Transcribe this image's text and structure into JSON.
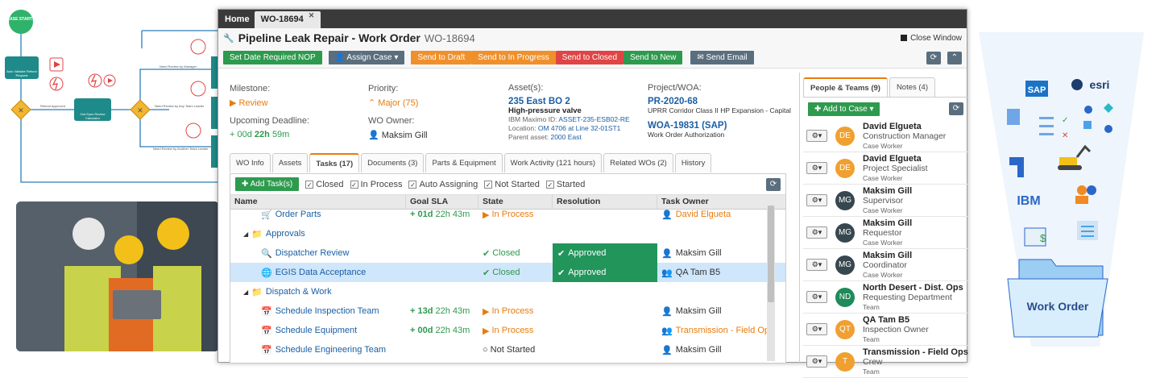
{
  "flow": {
    "start_label": "CASE STARTS",
    "step1_label": "Auto Validate Refund Request",
    "step2_label": "2nd Eyes Review Calculator",
    "refund_approved": "Refund Approved",
    "need_manager": "Need Review by Manager",
    "need_team_leader": "Need Review by Any Team Leader",
    "need_another": "Need Review by Another Team Leader"
  },
  "window": {
    "tabs": [
      {
        "label": "Home"
      },
      {
        "label": "WO-18694"
      }
    ],
    "title": "Pipeline Leak Repair - Work Order",
    "title_id": "WO-18694",
    "close_label": "Close Window"
  },
  "actions": {
    "set_date": "Set Date Required NOP",
    "assign": "Assign Case",
    "send_draft": "Send to Draft",
    "send_progress": "Send to In Progress",
    "send_closed": "Send to Closed",
    "send_new": "Send to New",
    "send_email": "Send Email"
  },
  "info": {
    "milestone_label": "Milestone:",
    "milestone_value": "Review",
    "deadline_label": "Upcoming Deadline:",
    "deadline_value": "+ 00d",
    "deadline_bold": "22h",
    "deadline_rest": "59m",
    "priority_label": "Priority:",
    "priority_value": "Major (75)",
    "owner_label": "WO Owner:",
    "owner_value": "Maksim Gill",
    "assets_label": "Asset(s):",
    "asset_name": "235 East BO 2",
    "asset_desc": "High-pressure valve",
    "asset_maximo_label": "IBM Maximo ID:",
    "asset_maximo": "ASSET-235-ESB02-RE",
    "asset_location_label": "Location:",
    "asset_location": "OM 4706 at Line 32-01ST1",
    "asset_parent_label": "Parent asset:",
    "asset_parent": "2000 East",
    "project_label": "Project/WOA:",
    "project_id": "PR-2020-68",
    "project_desc": "UPRR Corridor Class II HP Expansion - Capital",
    "woa_id": "WOA-19831 (SAP)",
    "woa_desc": "Work Order Authorization"
  },
  "subtabs": [
    {
      "label": "WO Info"
    },
    {
      "label": "Assets"
    },
    {
      "label": "Tasks (17)"
    },
    {
      "label": "Documents (3)"
    },
    {
      "label": "Parts & Equipment"
    },
    {
      "label": "Work Activity (121 hours)"
    },
    {
      "label": "Related WOs (2)"
    },
    {
      "label": "History"
    }
  ],
  "tasks": {
    "add_label": "Add Task(s)",
    "filters": [
      {
        "label": "Closed"
      },
      {
        "label": "In Process"
      },
      {
        "label": "Auto Assigning"
      },
      {
        "label": "Not Started"
      },
      {
        "label": "Started"
      }
    ],
    "columns": [
      "Name",
      "Goal SLA",
      "State",
      "Resolution",
      "Task Owner"
    ],
    "rows": [
      {
        "name": "Order Parts",
        "sla": "+ 01d",
        "sla_rest": "22h 43m",
        "state": "In Process",
        "resolution": "",
        "owner": "David Elgueta"
      },
      {
        "name": "Approvals"
      },
      {
        "name": "Dispatcher Review",
        "sla": "",
        "sla_rest": "",
        "state": "Closed",
        "resolution": "Approved",
        "owner": "Maksim Gill"
      },
      {
        "name": "EGIS Data Acceptance",
        "sla": "",
        "sla_rest": "",
        "state": "Closed",
        "resolution": "Approved",
        "owner": "QA Tam B5"
      },
      {
        "name": "Dispatch & Work"
      },
      {
        "name": "Schedule Inspection Team",
        "sla": "+ 13d",
        "sla_rest": "22h 43m",
        "state": "In Process",
        "resolution": "",
        "owner": "Maksim Gill"
      },
      {
        "name": "Schedule Equipment",
        "sla": "+ 00d",
        "sla_rest": "22h 43m",
        "state": "In Process",
        "resolution": "",
        "owner": "Transmission - Field Ops"
      },
      {
        "name": "Schedule Engineering Team",
        "sla": "",
        "sla_rest": "",
        "state": "Not Started",
        "resolution": "",
        "owner": "Maksim Gill"
      }
    ]
  },
  "people": {
    "tabs": [
      {
        "label": "People & Teams (9)"
      },
      {
        "label": "Notes (4)"
      }
    ],
    "add_label": "Add to Case",
    "list": [
      {
        "initials": "DE",
        "name": "David Elgueta",
        "role": "Construction Manager",
        "type": "Case Worker",
        "color": "#f0a030"
      },
      {
        "initials": "DE",
        "name": "David Elgueta",
        "role": "Project Specialist",
        "type": "Case Worker",
        "color": "#f0a030"
      },
      {
        "initials": "MG",
        "name": "Maksim Gill",
        "role": "Supervisor",
        "type": "Case Worker",
        "color": "#37474f"
      },
      {
        "initials": "MG",
        "name": "Maksim Gill",
        "role": "Requestor",
        "type": "Case Worker",
        "color": "#37474f"
      },
      {
        "initials": "MG",
        "name": "Maksim Gill",
        "role": "Coordinator",
        "type": "Case Worker",
        "color": "#37474f"
      },
      {
        "initials": "ND",
        "name": "North Desert - Dist. Ops",
        "role": "Requesting Department",
        "type": "Team",
        "color": "#1f8a5a"
      },
      {
        "initials": "QT",
        "name": "QA Tam B5",
        "role": "Inspection Owner",
        "type": "Team",
        "color": "#f0a030"
      },
      {
        "initials": "T",
        "name": "Transmission - Field Ops",
        "role": "Crew",
        "type": "Team",
        "color": "#f0a030"
      }
    ]
  },
  "illustration": {
    "brand1": "SAP",
    "brand2": "esri",
    "brand3": "IBM",
    "folder_label": "Work Order"
  },
  "colors": {
    "accent": "#e87c0e",
    "green": "#2e9a4e",
    "blue": "#1a5fa5",
    "red": "#e04444"
  }
}
